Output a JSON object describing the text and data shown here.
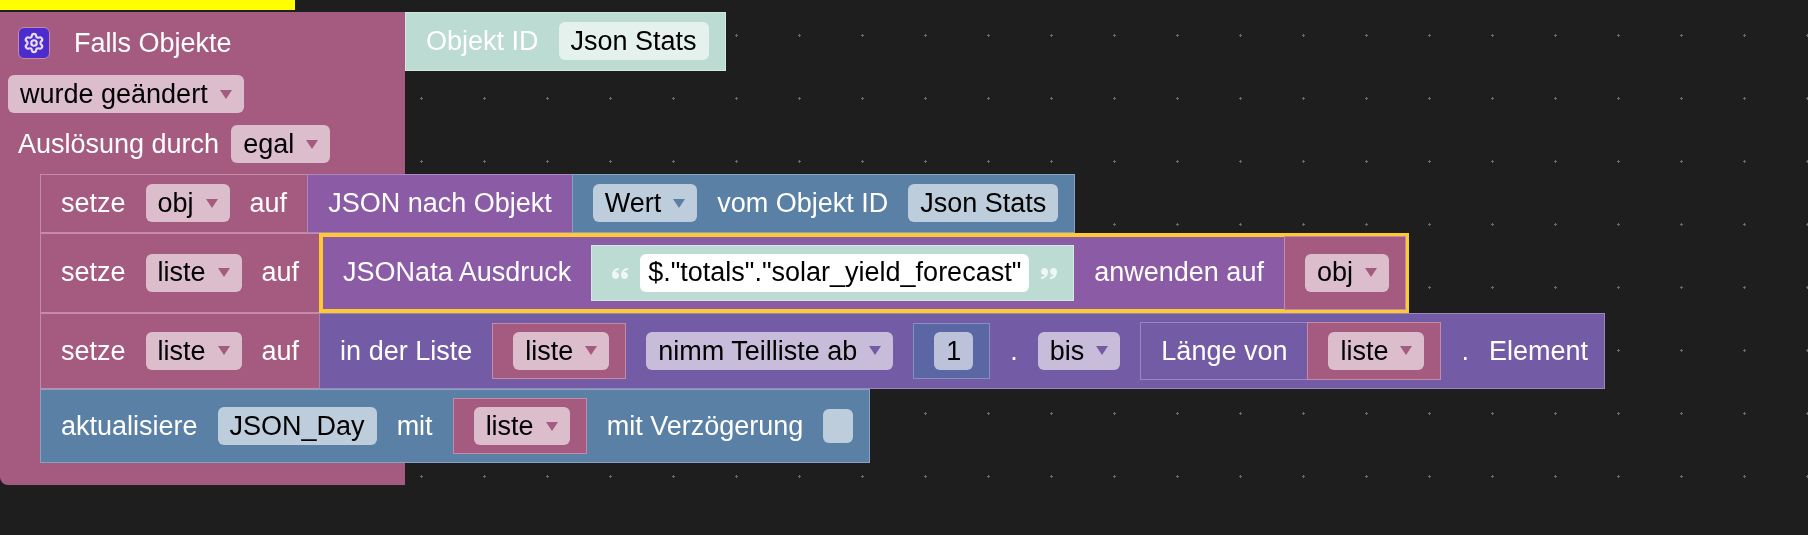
{
  "block_above": {
    "selected": true
  },
  "event_block": {
    "selected": false,
    "title": "Falls Objekte",
    "object_input": {
      "kind": "objectid",
      "selected": false,
      "parts": [
        {
          "kind": "label",
          "text": "Objekt ID"
        },
        {
          "kind": "field",
          "text": "Json Stats"
        }
      ]
    },
    "rows": [
      [
        {
          "kind": "dropdown",
          "text": "wurde geändert"
        }
      ],
      [
        {
          "kind": "label",
          "text": "Auslösung durch"
        },
        {
          "kind": "dropdown",
          "text": "egal"
        }
      ]
    ],
    "statements": [
      {
        "kind": "variables",
        "selected": false,
        "parts": [
          {
            "kind": "label",
            "text": "setze"
          },
          {
            "kind": "dropdown",
            "text": "obj"
          },
          {
            "kind": "label",
            "text": "auf"
          },
          {
            "kind": "json",
            "selected": false,
            "parts": [
              {
                "kind": "label",
                "text": "JSON nach Objekt"
              },
              {
                "kind": "objects",
                "selected": false,
                "parts": [
                  {
                    "kind": "dropdown",
                    "text": "Wert"
                  },
                  {
                    "kind": "label",
                    "text": "vom Objekt ID"
                  },
                  {
                    "kind": "field",
                    "text": "Json Stats"
                  }
                ]
              }
            ]
          }
        ]
      },
      {
        "kind": "variables",
        "selected": false,
        "parts": [
          {
            "kind": "label",
            "text": "setze"
          },
          {
            "kind": "dropdown",
            "text": "liste"
          },
          {
            "kind": "label",
            "text": "auf"
          },
          {
            "kind": "json",
            "selected": true,
            "parts": [
              {
                "kind": "label",
                "text": "JSONata Ausdruck"
              },
              {
                "kind": "text",
                "selected": false,
                "parts": [
                  {
                    "kind": "string",
                    "text": "$.\"totals\".\"solar_yield_forecast\""
                  }
                ]
              },
              {
                "kind": "label",
                "text": "anwenden auf"
              },
              {
                "kind": "variables",
                "selected": false,
                "parts": [
                  {
                    "kind": "dropdown",
                    "text": "obj"
                  }
                ]
              }
            ]
          }
        ]
      },
      {
        "kind": "variables",
        "selected": false,
        "parts": [
          {
            "kind": "label",
            "text": "setze"
          },
          {
            "kind": "dropdown",
            "text": "liste"
          },
          {
            "kind": "label",
            "text": "auf"
          },
          {
            "kind": "lists",
            "selected": false,
            "parts": [
              {
                "kind": "label",
                "text": "in der Liste"
              },
              {
                "kind": "variables",
                "selected": false,
                "parts": [
                  {
                    "kind": "dropdown",
                    "text": "liste"
                  }
                ]
              },
              {
                "kind": "dropdown",
                "text": "nimm Teilliste ab"
              },
              {
                "kind": "math",
                "selected": false,
                "parts": [
                  {
                    "kind": "field",
                    "text": "1"
                  }
                ]
              },
              {
                "kind": "label",
                "text": "."
              },
              {
                "kind": "dropdown",
                "text": "bis"
              },
              {
                "kind": "lists",
                "selected": false,
                "parts": [
                  {
                    "kind": "label",
                    "text": "Länge von"
                  },
                  {
                    "kind": "variables",
                    "selected": false,
                    "parts": [
                      {
                        "kind": "dropdown",
                        "text": "liste"
                      }
                    ]
                  }
                ]
              },
              {
                "kind": "label",
                "text": "."
              },
              {
                "kind": "label",
                "text": "Element"
              }
            ]
          }
        ]
      },
      {
        "kind": "objects",
        "selected": false,
        "parts": [
          {
            "kind": "label",
            "text": "aktualisiere"
          },
          {
            "kind": "field",
            "text": "JSON_Day"
          },
          {
            "kind": "label",
            "text": "mit"
          },
          {
            "kind": "variables",
            "selected": false,
            "parts": [
              {
                "kind": "dropdown",
                "text": "liste"
              }
            ]
          },
          {
            "kind": "label",
            "text": "mit Verzögerung"
          },
          {
            "kind": "checkbox",
            "checked": false
          }
        ]
      }
    ]
  }
}
